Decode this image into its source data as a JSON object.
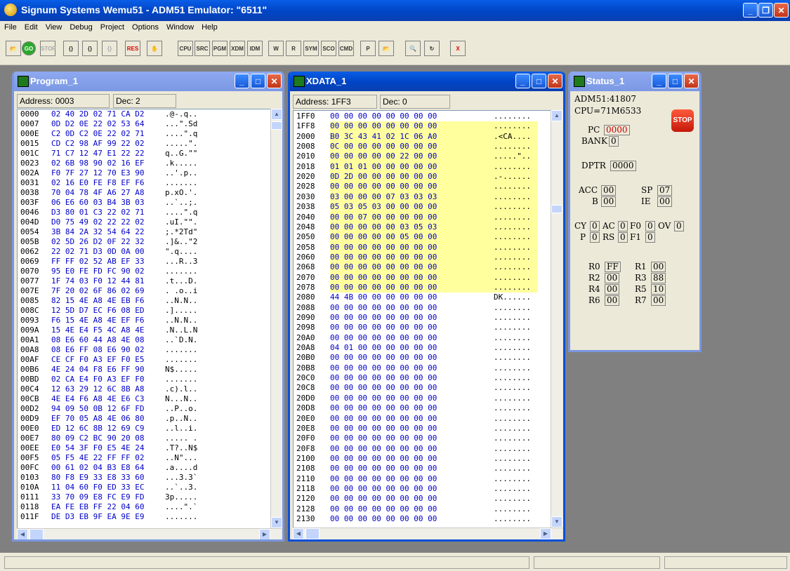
{
  "app": {
    "title": "Signum Systems Wemu51 - ADM51 Emulator: \"6511\"",
    "colors": {
      "title_bar": "#0046c8",
      "hex_bytes": "#0000c8",
      "highlight": "#ffff9e",
      "pc_value": "#c80000"
    }
  },
  "menu": [
    "File",
    "Edit",
    "View",
    "Debug",
    "Project",
    "Options",
    "Window",
    "Help"
  ],
  "toolbar": {
    "buttons": [
      {
        "name": "open-file-icon",
        "label": "📂"
      },
      {
        "name": "go-button",
        "label": "GO"
      },
      {
        "name": "stop-button",
        "label": "STOP"
      },
      {
        "name": "step-into-button",
        "label": "{}"
      },
      {
        "name": "step-over-button",
        "label": "{}"
      },
      {
        "name": "step-out-button",
        "label": "{}"
      },
      {
        "name": "reset-button",
        "label": "RES"
      },
      {
        "name": "hand-button",
        "label": "✋"
      },
      {
        "name": "cpu-window-button",
        "label": "CPU"
      },
      {
        "name": "source-window-button",
        "label": "SRC"
      },
      {
        "name": "program-window-button",
        "label": "PGM"
      },
      {
        "name": "xdata-window-button",
        "label": "XDM"
      },
      {
        "name": "idata-window-button",
        "label": "IDM"
      },
      {
        "name": "watch-window-button",
        "label": "W"
      },
      {
        "name": "register-window-button",
        "label": "R"
      },
      {
        "name": "symbols-window-button",
        "label": "SYM"
      },
      {
        "name": "scope-window-button",
        "label": "SCO"
      },
      {
        "name": "command-window-button",
        "label": "CMD"
      },
      {
        "name": "project-button",
        "label": "P"
      },
      {
        "name": "open-project-button",
        "label": "📂"
      },
      {
        "name": "find-button",
        "label": "🔍"
      },
      {
        "name": "refresh-button",
        "label": "↻"
      },
      {
        "name": "exit-button",
        "label": "X"
      }
    ]
  },
  "program_window": {
    "title": "Program_1",
    "address_label": "Address: 0003",
    "dec_label": "Dec:  2",
    "rows": [
      [
        "0000",
        "02 40 2D 02 71 CA D2",
        ".@-.q.."
      ],
      [
        "0007",
        "0D D2 0E 22 02 53 64",
        "...\".Sd"
      ],
      [
        "000E",
        "C2 0D C2 0E 22 02 71",
        "....\".q"
      ],
      [
        "0015",
        "CD C2 98 AF 99 22 02",
        ".....\"."
      ],
      [
        "001C",
        "71 C7 12 47 E1 22 22",
        "q..G.\"\""
      ],
      [
        "0023",
        "02 6B 98 90 02 16 EF",
        ".k....."
      ],
      [
        "002A",
        "F0 7F 27 12 70 E3 90",
        "..'.p.."
      ],
      [
        "0031",
        "02 16 E0 FE F8 EF F6",
        "......."
      ],
      [
        "0038",
        "70 04 78 4F A6 27 A8",
        "p.xO.'."
      ],
      [
        "003F",
        "06 E6 60 03 B4 3B 03",
        "..`..;."
      ],
      [
        "0046",
        "D3 80 01 C3 22 02 71",
        "....\".q"
      ],
      [
        "004D",
        "D0 75 49 02 22 22 02",
        ".uI.\"\"."
      ],
      [
        "0054",
        "3B 84 2A 32 54 64 22",
        ";.*2Td\""
      ],
      [
        "005B",
        "02 5D 26 D2 0F 22 32",
        ".]&..\"2"
      ],
      [
        "0062",
        "22 02 71 D3 0D 0A 00",
        "\".q...."
      ],
      [
        "0069",
        "FF FF 02 52 AB EF 33",
        "...R..3"
      ],
      [
        "0070",
        "95 E0 FE FD FC 90 02",
        "......."
      ],
      [
        "0077",
        "1F 74 03 F0 12 44 81",
        ".t...D."
      ],
      [
        "007E",
        "7F 20 02 6F 86 02 69",
        ". .o..i"
      ],
      [
        "0085",
        "82 15 4E A8 4E EB F6",
        "..N.N.."
      ],
      [
        "008C",
        "12 5D D7 EC F6 08 ED",
        ".]....."
      ],
      [
        "0093",
        "F6 15 4E A8 4E EF F6",
        "..N.N.."
      ],
      [
        "009A",
        "15 4E E4 F5 4C A8 4E",
        ".N..L.N"
      ],
      [
        "00A1",
        "08 E6 60 44 A8 4E 08",
        "..`D.N."
      ],
      [
        "00A8",
        "08 E6 FF 08 E6 90 02",
        "......."
      ],
      [
        "00AF",
        "CE CF F0 A3 EF F0 E5",
        "......."
      ],
      [
        "00B6",
        "4E 24 04 F8 E6 FF 90",
        "N$....."
      ],
      [
        "00BD",
        "02 CA E4 F0 A3 EF F0",
        "......."
      ],
      [
        "00C4",
        "12 63 29 12 6C 8B A8",
        ".c).l.."
      ],
      [
        "00CB",
        "4E E4 F6 A8 4E E6 C3",
        "N...N.."
      ],
      [
        "00D2",
        "94 09 50 0B 12 6F FD",
        "..P..o."
      ],
      [
        "00D9",
        "EF 70 05 A8 4E 06 80",
        ".p..N.."
      ],
      [
        "00E0",
        "ED 12 6C 8B 12 69 C9",
        "..l..i."
      ],
      [
        "00E7",
        "80 09 C2 BC 90 20 08",
        "..... ."
      ],
      [
        "00EE",
        "E0 54 3F F0 E5 4E 24",
        ".T?..N$"
      ],
      [
        "00F5",
        "05 F5 4E 22 FF FF 02",
        "..N\"..."
      ],
      [
        "00FC",
        "00 61 02 04 B3 E8 64",
        ".a....d"
      ],
      [
        "0103",
        "80 F8 E9 33 E8 33 60",
        "...3.3`"
      ],
      [
        "010A",
        "11 04 60 F0 ED 33 EC",
        "..`..3."
      ],
      [
        "0111",
        "33 70 09 E8 FC E9 FD",
        "3p....."
      ],
      [
        "0118",
        "EA FE EB FF 22 04 60",
        "....\".`"
      ],
      [
        "011F",
        "DE D3 EB 9F EA 9E E9",
        "......."
      ]
    ]
  },
  "xdata_window": {
    "title": "XDATA_1",
    "address_label": "Address: 1FF3",
    "dec_label": "Dec:  0",
    "rows": [
      [
        "1FF0",
        "00 00 00 00 00 00 00 00",
        "........"
      ],
      [
        "1FF8",
        "00 00 00 00 00 00 00 00",
        "........"
      ],
      [
        "2000",
        "B0 3C 43 41 02 1C 06 A0",
        ".<CA...."
      ],
      [
        "2008",
        "0C 00 00 00 00 00 00 00",
        "........"
      ],
      [
        "2010",
        "00 00 00 00 00 22 00 00",
        ".....\".."
      ],
      [
        "2018",
        "01 01 01 00 00 00 00 00",
        "........"
      ],
      [
        "2020",
        "0D 2D 00 00 00 00 00 00",
        ".-......"
      ],
      [
        "2028",
        "00 00 00 00 00 00 00 00",
        "........"
      ],
      [
        "2030",
        "03 00 00 00 07 03 03 03",
        "........"
      ],
      [
        "2038",
        "05 03 05 03 00 00 00 00",
        "........"
      ],
      [
        "2040",
        "00 00 07 00 00 00 00 00",
        "........"
      ],
      [
        "2048",
        "00 00 00 00 00 03 05 03",
        "........"
      ],
      [
        "2050",
        "00 00 00 00 00 05 00 00",
        "........"
      ],
      [
        "2058",
        "00 00 00 00 00 00 00 00",
        "........"
      ],
      [
        "2060",
        "00 00 00 00 00 00 00 00",
        "........"
      ],
      [
        "2068",
        "00 00 00 00 00 00 00 00",
        "........"
      ],
      [
        "2070",
        "00 00 00 00 00 00 00 00",
        "........"
      ],
      [
        "2078",
        "00 00 00 00 00 00 00 00",
        "........"
      ],
      [
        "2080",
        "44 4B 00 00 00 00 00 00",
        "DK......"
      ],
      [
        "2088",
        "00 00 00 00 00 00 00 00",
        "........"
      ],
      [
        "2090",
        "00 00 00 00 00 00 00 00",
        "........"
      ],
      [
        "2098",
        "00 00 00 00 00 00 00 00",
        "........"
      ],
      [
        "20A0",
        "00 00 00 00 00 00 00 00",
        "........"
      ],
      [
        "20A8",
        "04 01 00 00 00 00 00 00",
        "........"
      ],
      [
        "20B0",
        "00 00 00 00 00 00 00 00",
        "........"
      ],
      [
        "20B8",
        "00 00 00 00 00 00 00 00",
        "........"
      ],
      [
        "20C0",
        "00 00 00 00 00 00 00 00",
        "........"
      ],
      [
        "20C8",
        "00 00 00 00 00 00 00 00",
        "........"
      ],
      [
        "20D0",
        "00 00 00 00 00 00 00 00",
        "........"
      ],
      [
        "20D8",
        "00 00 00 00 00 00 00 00",
        "........"
      ],
      [
        "20E0",
        "00 00 00 00 00 00 00 00",
        "........"
      ],
      [
        "20E8",
        "00 00 00 00 00 00 00 00",
        "........"
      ],
      [
        "20F0",
        "00 00 00 00 00 00 00 00",
        "........"
      ],
      [
        "20F8",
        "00 00 00 00 00 00 00 00",
        "........"
      ],
      [
        "2100",
        "00 00 00 00 00 00 00 00",
        "........"
      ],
      [
        "2108",
        "00 00 00 00 00 00 00 00",
        "........"
      ],
      [
        "2110",
        "00 00 00 00 00 00 00 00",
        "........"
      ],
      [
        "2118",
        "00 00 00 00 00 00 00 00",
        "........"
      ],
      [
        "2120",
        "00 00 00 00 00 00 00 00",
        "........"
      ],
      [
        "2128",
        "00 00 00 00 00 00 00 00",
        "........"
      ],
      [
        "2130",
        "00 00 00 00 00 00 00 00",
        "........"
      ]
    ]
  },
  "status_window": {
    "title": "Status_1",
    "device": "ADM51:41807",
    "cpu": "CPU=71M6533",
    "stop_label": "STOP",
    "pc_label": "PC",
    "pc": "0000",
    "bank_label": "BANK",
    "bank": "0",
    "dptr_label": "DPTR",
    "dptr": "0000",
    "acc_label": "ACC",
    "acc": "00",
    "sp_label": "SP",
    "sp": "07",
    "b_label": "B",
    "b": "00",
    "ie_label": "IE",
    "ie": "00",
    "cy_label": "CY",
    "cy": "0",
    "ac_label": "AC",
    "ac": "0",
    "f0_label": "F0",
    "f0": "0",
    "ov_label": "OV",
    "ov": "0",
    "p_label": "P",
    "p": "0",
    "rs_label": "RS",
    "rs": "0",
    "f1_label": "F1",
    "f1": "0",
    "r0_label": "R0",
    "r0": "FF",
    "r1_label": "R1",
    "r1": "00",
    "r2_label": "R2",
    "r2": "00",
    "r3_label": "R3",
    "r3": "88",
    "r4_label": "R4",
    "r4": "00",
    "r5_label": "R5",
    "r5": "10",
    "r6_label": "R6",
    "r6": "00",
    "r7_label": "R7",
    "r7": "00"
  }
}
